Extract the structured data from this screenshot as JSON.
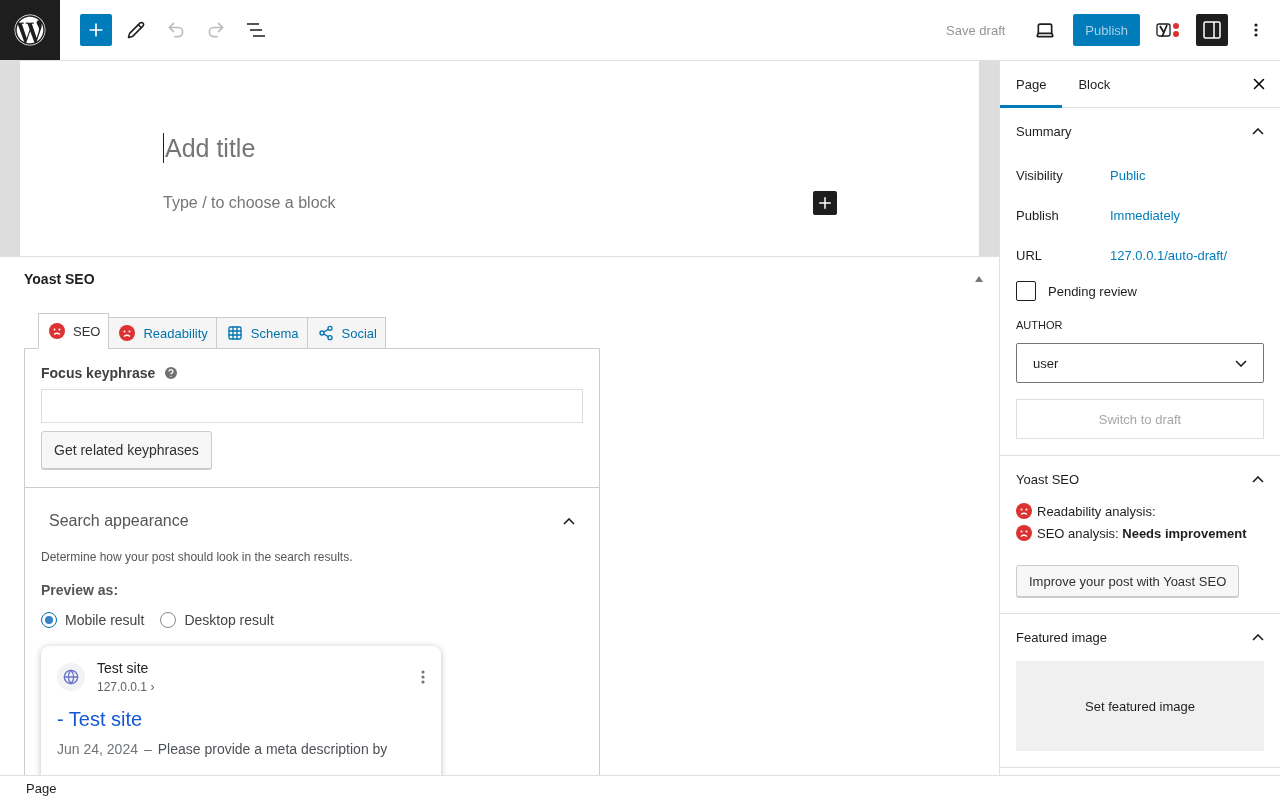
{
  "toolbar": {
    "save_draft": "Save draft",
    "publish": "Publish",
    "settings_open": true
  },
  "editor": {
    "title_placeholder": "Add title",
    "block_placeholder": "Type / to choose a block"
  },
  "metabox": {
    "title": "Yoast SEO",
    "expanded": true,
    "tabs": [
      {
        "label": "SEO",
        "kind": "score",
        "selected": true
      },
      {
        "label": "Readability",
        "kind": "score",
        "selected": false
      },
      {
        "label": "Schema",
        "kind": "schema",
        "selected": false
      },
      {
        "label": "Social",
        "kind": "social",
        "selected": false
      }
    ],
    "focus_keyphrase": {
      "label": "Focus keyphrase"
    },
    "related_button": "Get related keyphrases",
    "search_appearance": {
      "title": "Search appearance",
      "expanded": true,
      "description": "Determine how your post should look in the search results.",
      "preview_label": "Preview as:",
      "options": [
        {
          "label": "Mobile result",
          "selected": true
        },
        {
          "label": "Desktop result",
          "selected": false
        }
      ],
      "snippet": {
        "site_name": "Test site",
        "url": "127.0.0.1 ›",
        "title": "- Test site",
        "date": "Jun 24, 2024",
        "separator": "–",
        "description": "Please provide a meta description by"
      }
    }
  },
  "sidebar": {
    "tabs": [
      {
        "label": "Page",
        "selected": true
      },
      {
        "label": "Block",
        "selected": false
      }
    ],
    "summary": {
      "title": "Summary",
      "expanded": true,
      "rows": [
        {
          "label": "Visibility",
          "value": "Public"
        },
        {
          "label": "Publish",
          "value": "Immediately"
        },
        {
          "label": "URL",
          "value": "127.0.0.1/auto-draft/"
        }
      ],
      "pending_review": {
        "label": "Pending review",
        "checked": false
      },
      "author_label": "AUTHOR",
      "author": "user",
      "switch_button": "Switch to draft"
    },
    "yoast": {
      "title": "Yoast SEO",
      "expanded": true,
      "analyses": [
        {
          "text": "Readability analysis:"
        },
        {
          "text": "SEO analysis: **Needs improvement**"
        }
      ],
      "button": "Improve your post with Yoast SEO"
    },
    "featured": {
      "title": "Featured image",
      "expanded": true,
      "button": "Set featured image"
    }
  },
  "status_bar": {
    "breadcrumb": "Page"
  }
}
